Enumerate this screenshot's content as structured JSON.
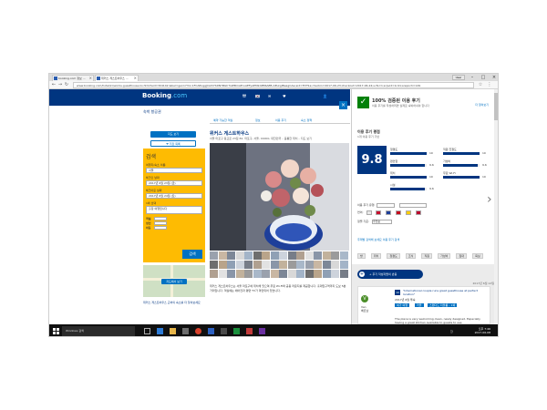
{
  "browser": {
    "tabs": [
      {
        "label": "booking.com 정보 ..."
      },
      {
        "label": "위커스 게스트하우스 ..."
      }
    ],
    "user_label": "User",
    "url": "www.booking.com/hotel/kr/works-guesthouse.ko.html?aid=304142;label=gen173nr-1FCAEoggJCAlhYSDNYBGh7iAEBmAEruAEFyAEM2AEB6AEB-AELkgIBeagCAw;sid=f37f1a;checkin=2017-06-23;checkout=2017-06-24;ucfs=1;srpvid=1c41;srepoch=149"
  },
  "header": {
    "logo_main": "Booking",
    "logo_suffix": ".com",
    "icons": [
      "₩",
      "🇰🇷",
      "✉",
      "♥",
      "👤"
    ]
  },
  "left": {
    "top_links": "숙박  항공권",
    "map_button": "지도 보기",
    "share_label": "❤ 저장 목록",
    "search": {
      "title": "검색",
      "dest_label": "여행지/숙소 이름:",
      "dest_value": "서울",
      "checkin_label": "체크인 날짜",
      "checkin_value": "2017년 6월 23일 (금)",
      "checkout_label": "체크아웃 날짜",
      "checkout_value": "2017년 6월 24일 (토)",
      "nights": "1박 선택",
      "purpose_label": "출장 여행입니다",
      "rooms_label": "객실",
      "adults_label": "성인",
      "children_label": "아동",
      "button": "검색"
    },
    "map_link": "지도에서 보기",
    "bottom_text": "위커스 게스트하우스 근처의 숙소를 더 찾아보세요"
  },
  "center": {
    "tabs": [
      "예약 가능한 객실",
      "정보",
      "이용 후기",
      "숙소 정책",
      "주소"
    ],
    "hotel_name": "위커스 게스트하우스",
    "address": "서울 마포구 동교로 23길 82, 마포구, 서울, 04000, 대한민국 – 훌륭한 위치 – 지도 보기",
    "description": "위커스 게스트하우스는 서울 마포구에 위치해 있으며 무료 Wi-Fi와 공용 라운지를 제공합니다. 홍대입구역까지 도보 5분 거리입니다. 객실에는 에어컨과 평면 TV가 마련되어 있습니다."
  },
  "modal": {
    "title": "100% 검증된 이용 후기",
    "subtitle": "이용 후기를 작성하려면 실제로 숙박하셔야 합니다",
    "link": "더 알아보기",
    "section": "이용 후기 평점",
    "section_sub": "1개 이용 후기 기반",
    "score": "9.8",
    "categories": [
      {
        "label": "청결도",
        "value": "10",
        "pct": 100
      },
      {
        "label": "편안함",
        "value": "9.6",
        "pct": 96
      },
      {
        "label": "위치",
        "value": "10",
        "pct": 100
      },
      {
        "label": "시설",
        "value": "9.6",
        "pct": 96
      },
      {
        "label": "직원 친절도",
        "value": "10",
        "pct": 100
      },
      {
        "label": "가성비",
        "value": "9.6",
        "pct": 96
      },
      {
        "label": "무료 Wi-Fi",
        "value": "10",
        "pct": 100
      }
    ],
    "filter_type": "이용 후기 유형:",
    "filter_lang": "언어:",
    "filter_sort": "정렬 기준:",
    "filter_sort_value": "추천순",
    "search_label": "주제별 검색해 보세요  이용 후기 검색",
    "chips": [
      "방",
      "위치",
      "청결도",
      "조식",
      "직원",
      "가성비",
      "침대",
      "욕실",
      "와이파이",
      "편안함"
    ],
    "show_all": "+ 후기 작성자들의 반응",
    "review": {
      "date": "2017년 6월 12일",
      "avatar": "V",
      "name": "Van",
      "country": "베트남",
      "score": "10",
      "title": "\"International couple runs great guesthouse at perfect location\"",
      "meta": "2017년 6월 투숙",
      "tags": [
        "여가 여행",
        "커플",
        "스탠다드 더블룸 – 1박"
      ],
      "body": "The place is very welcoming clean, newly designed. Especially having a great kitchen available to guests to use"
    }
  },
  "taskbar": {
    "search_placeholder": "Windows 검색",
    "time": "오후 7:46",
    "date": "2017-06-08",
    "lang": "한"
  }
}
